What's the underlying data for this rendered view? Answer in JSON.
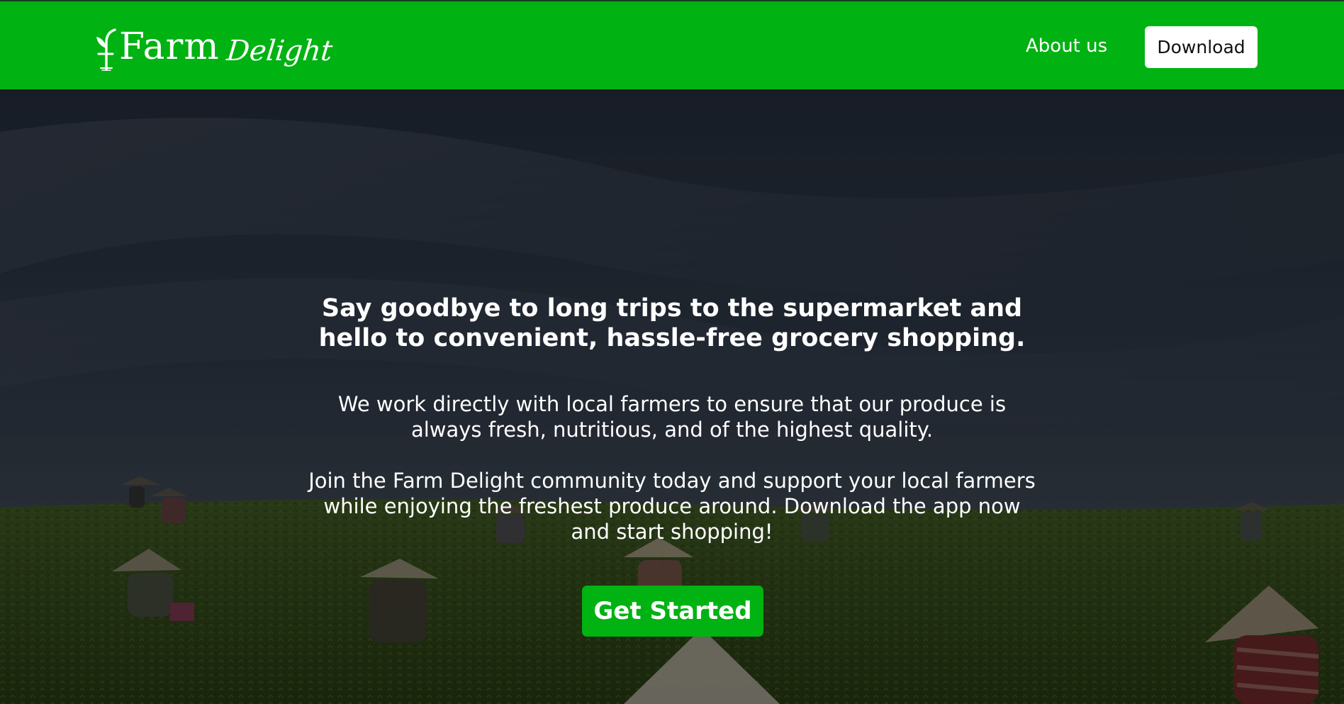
{
  "brand": {
    "name_part1": "Farm",
    "name_part2": "Delight",
    "primary_color": "#00b212"
  },
  "nav": {
    "about_label": "About us",
    "download_label": "Download"
  },
  "hero": {
    "headline": "Say goodbye to long trips to the supermarket and hello to convenient, hassle-free grocery shopping.",
    "paragraph1": "We work directly with local farmers to ensure that our produce is always fresh, nutritious, and of the highest quality.",
    "paragraph2": "Join the Farm Delight community today and support your local farmers while enjoying the freshest produce around. Download the app now and start shopping!",
    "cta_label": "Get Started",
    "background": "farm-field-photo"
  }
}
